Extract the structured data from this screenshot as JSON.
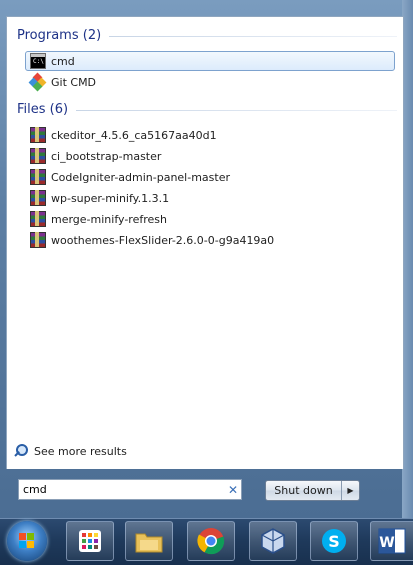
{
  "programs": {
    "header": "Programs (2)",
    "items": [
      {
        "label": "cmd",
        "icon": "command-prompt-icon",
        "selected": true
      },
      {
        "label": "Git CMD",
        "icon": "git-icon",
        "selected": false
      }
    ]
  },
  "files": {
    "header": "Files (6)",
    "items": [
      {
        "label": "ckeditor_4.5.6_ca5167aa40d1",
        "icon": "winrar-archive-icon"
      },
      {
        "label": "ci_bootstrap-master",
        "icon": "winrar-archive-icon"
      },
      {
        "label": "CodeIgniter-admin-panel-master",
        "icon": "winrar-archive-icon"
      },
      {
        "label": "wp-super-minify.1.3.1",
        "icon": "winrar-archive-icon"
      },
      {
        "label": "merge-minify-refresh",
        "icon": "winrar-archive-icon"
      },
      {
        "label": "woothemes-FlexSlider-2.6.0-0-g9a419a0",
        "icon": "winrar-archive-icon"
      }
    ]
  },
  "see_more": {
    "label": "See more results",
    "icon": "search-icon"
  },
  "search": {
    "value": "cmd",
    "clear_icon": "clear-icon"
  },
  "shutdown": {
    "label": "Shut down",
    "arrow_icon": "arrow-right-icon"
  },
  "taskbar": {
    "start_icon": "windows-start-orb-icon",
    "buttons": [
      {
        "name": "app-launcher-icon"
      },
      {
        "name": "file-explorer-icon"
      },
      {
        "name": "chrome-icon"
      },
      {
        "name": "virtualbox-icon"
      },
      {
        "name": "skype-icon"
      },
      {
        "name": "word-icon"
      }
    ]
  },
  "colors": {
    "header_text": "#1e3287",
    "selected_bg": "#dcebfc",
    "selected_border": "#7da2ce",
    "taskbar": "#1f3a5c"
  }
}
